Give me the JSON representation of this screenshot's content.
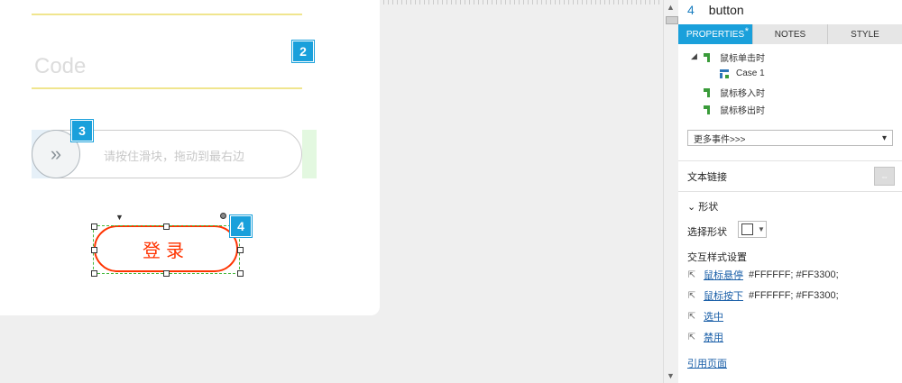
{
  "canvas": {
    "code_placeholder": "Code",
    "slider_hint": "请按住滑块，拖动到最右边",
    "slider_knob_glyph": "»",
    "login_label": "登录",
    "badges": [
      "2",
      "3",
      "4"
    ]
  },
  "panel": {
    "index": "4",
    "name": "button",
    "tabs": [
      {
        "label": "PROPERTIES",
        "active": true,
        "star": "*"
      },
      {
        "label": "NOTES"
      },
      {
        "label": "STYLE"
      }
    ],
    "events": [
      {
        "label": "鼠标单击时",
        "expanded": true,
        "cases": [
          "Case 1"
        ]
      },
      {
        "label": "鼠标移入时"
      },
      {
        "label": "鼠标移出时"
      }
    ],
    "more_events": "更多事件>>>",
    "text_link_label": "文本链接",
    "shape_section": "形状",
    "select_shape_label": "选择形状",
    "interaction_title": "交互样式设置",
    "interactions": [
      {
        "label": "鼠标悬停",
        "value": "#FFFFFF; #FF3300;"
      },
      {
        "label": "鼠标按下",
        "value": "#FFFFFF; #FF3300;"
      },
      {
        "label": "选中",
        "value": ""
      },
      {
        "label": "禁用",
        "value": ""
      }
    ],
    "reference_page": "引用页面"
  },
  "colors": {
    "accent": "#1aa0db",
    "brand_red": "#FF3300",
    "white": "#FFFFFF"
  }
}
